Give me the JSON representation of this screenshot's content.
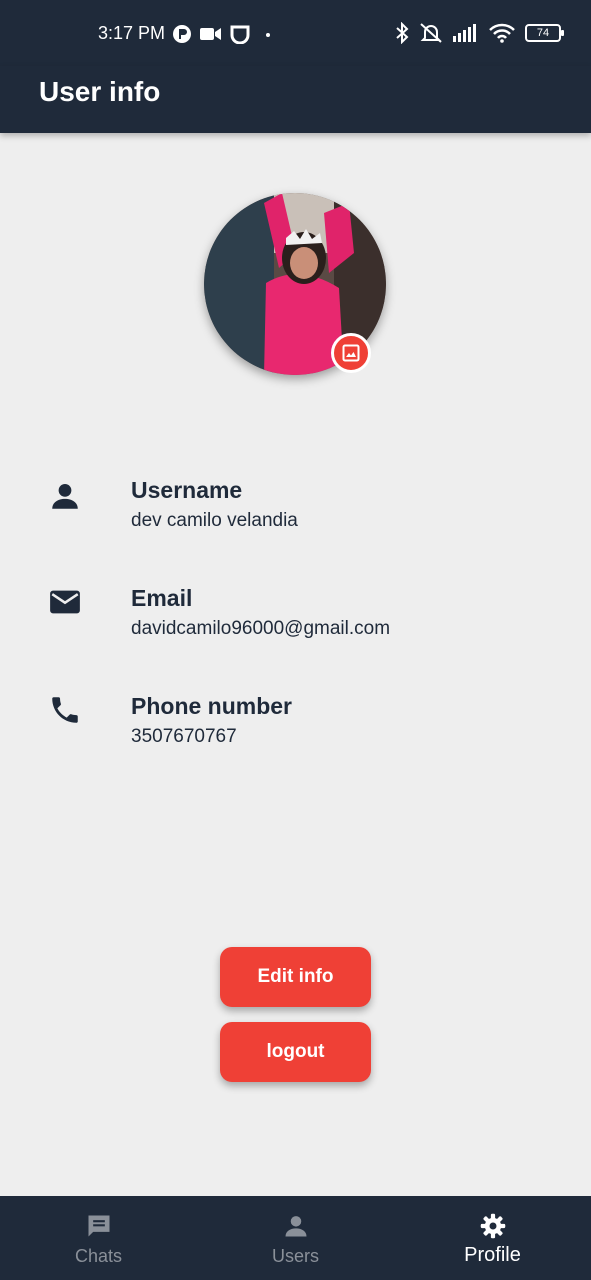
{
  "status_bar": {
    "time": "3:17 PM",
    "battery": "74"
  },
  "app_bar": {
    "title": "User info"
  },
  "profile": {
    "fields": [
      {
        "icon": "person-icon",
        "label": "Username",
        "value": "dev camilo velandia"
      },
      {
        "icon": "email-icon",
        "label": "Email",
        "value": "davidcamilo96000@gmail.com"
      },
      {
        "icon": "phone-icon",
        "label": "Phone number",
        "value": "3507670767"
      }
    ]
  },
  "actions": {
    "edit_label": "Edit info",
    "logout_label": "logout"
  },
  "bottom_nav": {
    "items": [
      {
        "label": "Chats",
        "icon": "chat-icon",
        "active": false
      },
      {
        "label": "Users",
        "icon": "person-icon",
        "active": false
      },
      {
        "label": "Profile",
        "icon": "gear-icon",
        "active": true
      }
    ]
  },
  "colors": {
    "primary": "#1f2a3a",
    "accent": "#ef4036",
    "background": "#eeeeee"
  }
}
